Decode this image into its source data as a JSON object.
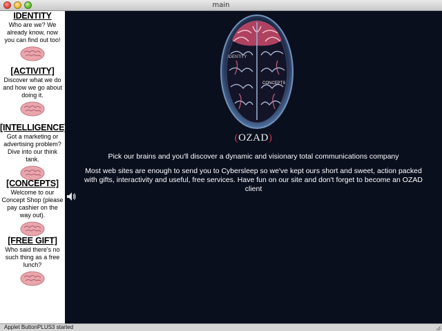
{
  "window": {
    "title": "main"
  },
  "sidebar": {
    "sections": [
      {
        "title": "IDENTITY",
        "desc": "Who are we? We already know, now you can find out too!"
      },
      {
        "title": "[ACTIVITY]",
        "desc": "Discover what we do and how we go about doing it."
      },
      {
        "title": "[INTELLIGENCE]",
        "desc": "Got a marketing or advertising problem? Dive into our think tank."
      },
      {
        "title": "[CONCEPTS]",
        "desc": "Welcome to our Concept Shop (please pay cashier on the way out)."
      },
      {
        "title": "[FREE GIFT]",
        "desc": "Who said there's no such thing as a free lunch?"
      }
    ]
  },
  "hero": {
    "labels": [
      "IDENTITY",
      "CONCEPTS"
    ],
    "brand_open": "(",
    "brand_name": "OZAD",
    "brand_close": ")"
  },
  "main": {
    "tagline": "Pick our brains and you'll discover a dynamic and visionary total communications company",
    "body": "Most web sites are enough to send you to Cybersleep so we've kept ours short and sweet, action packed with gifts, interactivity and useful, free services. Have fun on our site and don't forget to become an OZAD client"
  },
  "status": {
    "text": "Applet ButtonPLUS3 started"
  },
  "icons": {
    "close": "close-icon",
    "minimize": "minimize-icon",
    "zoom": "zoom-icon",
    "speaker": "speaker-icon",
    "brain": "brain-icon"
  },
  "colors": {
    "main_bg": "#0a0f1e",
    "sidebar_bg": "#ffffff",
    "brand_paren": "#d8324a",
    "brain_pink": "#e8a2a8"
  }
}
